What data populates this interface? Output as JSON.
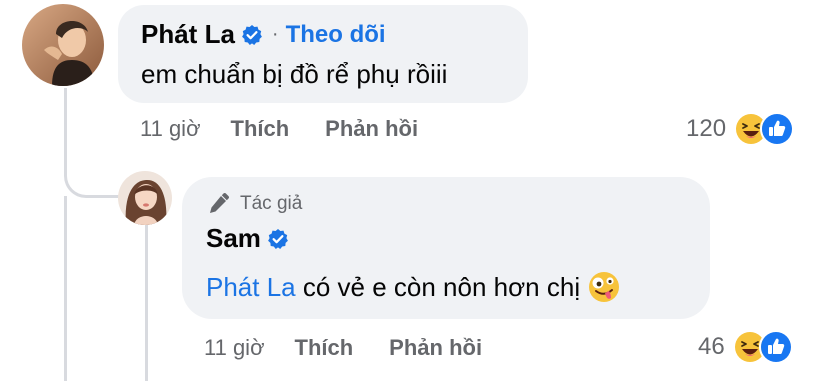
{
  "comment": {
    "author_name": "Phát La",
    "follow_label": "Theo dõi",
    "separator": "·",
    "text": "em chuẩn bị đồ rể phụ rồiii",
    "time": "11 giờ",
    "like_label": "Thích",
    "reply_label": "Phản hồi",
    "reaction_count": "120"
  },
  "reply": {
    "author_badge": "Tác giả",
    "author_name": "Sam",
    "mention": "Phát La",
    "text": " có vẻ e còn nôn hơn chị ",
    "time": "11 giờ",
    "like_label": "Thích",
    "reply_label": "Phản hồi",
    "reaction_count": "46"
  },
  "icons": {
    "verified": "verified-badge-icon",
    "pen": "pen-icon",
    "haha": "haha-reaction-icon",
    "like": "like-reaction-icon",
    "zany_emoji": "zany-face-emoji"
  },
  "colors": {
    "bubble": "#f0f2f5",
    "accent_blue": "#1b74e4",
    "meta_gray": "#65676b",
    "thread_line": "#d8dadf"
  }
}
